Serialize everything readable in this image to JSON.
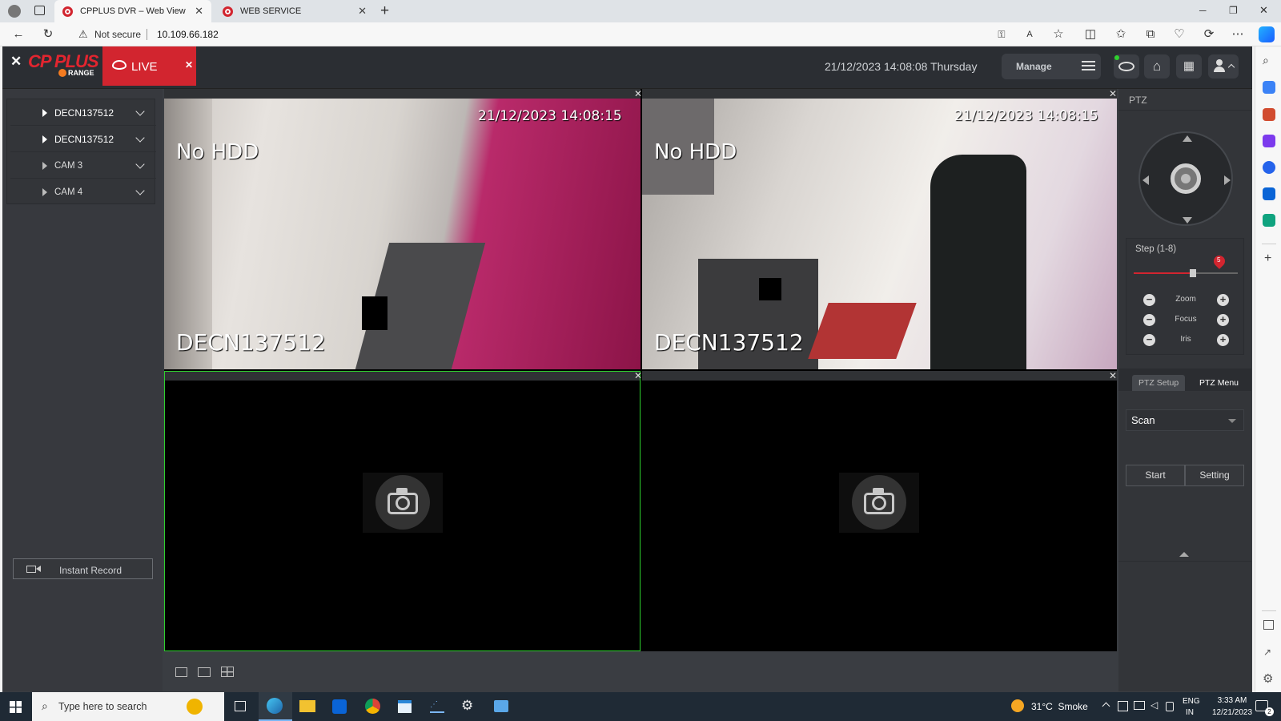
{
  "browser": {
    "tabs": [
      {
        "title": "CPPLUS DVR – Web View"
      },
      {
        "title": "WEB SERVICE"
      }
    ],
    "security_label": "Not secure",
    "url": "10.109.66.182"
  },
  "app": {
    "logo": "CP PLUS",
    "logo_sub": "RANGE",
    "live_label": "LIVE",
    "datetime": "21/12/2023 14:08:08 Thursday",
    "manage_label": "Manage"
  },
  "sidebar": {
    "items": [
      {
        "label": "DECN137512"
      },
      {
        "label": "DECN137512"
      },
      {
        "label": "CAM 3"
      },
      {
        "label": "CAM 4"
      }
    ],
    "instant_record": "Instant Record"
  },
  "cameras": [
    {
      "timestamp": "21/12/2023 14:08:15",
      "status": "No HDD",
      "name": "DECN137512"
    },
    {
      "timestamp": "21/12/2023 14:08:15",
      "status": "No HDD",
      "name": "DECN137512"
    }
  ],
  "ptz": {
    "title": "PTZ",
    "step_label": "Step (1-8)",
    "step_value": "5",
    "step_fraction": 0.57,
    "rows": [
      {
        "label": "Zoom"
      },
      {
        "label": "Focus"
      },
      {
        "label": "Iris"
      }
    ],
    "tab_setup": "PTZ Setup",
    "tab_menu": "PTZ Menu",
    "select_value": "Scan",
    "start_label": "Start",
    "setting_label": "Setting"
  },
  "taskbar": {
    "search_placeholder": "Type here to search",
    "weather": "31°C  Smoke",
    "lang_top": "ENG",
    "lang_bottom": "IN",
    "time": "3:33 AM",
    "date": "12/21/2023",
    "notif_count": "2"
  },
  "colors": {
    "brand_red": "#d2252f",
    "accent_green": "#2ed12e"
  }
}
